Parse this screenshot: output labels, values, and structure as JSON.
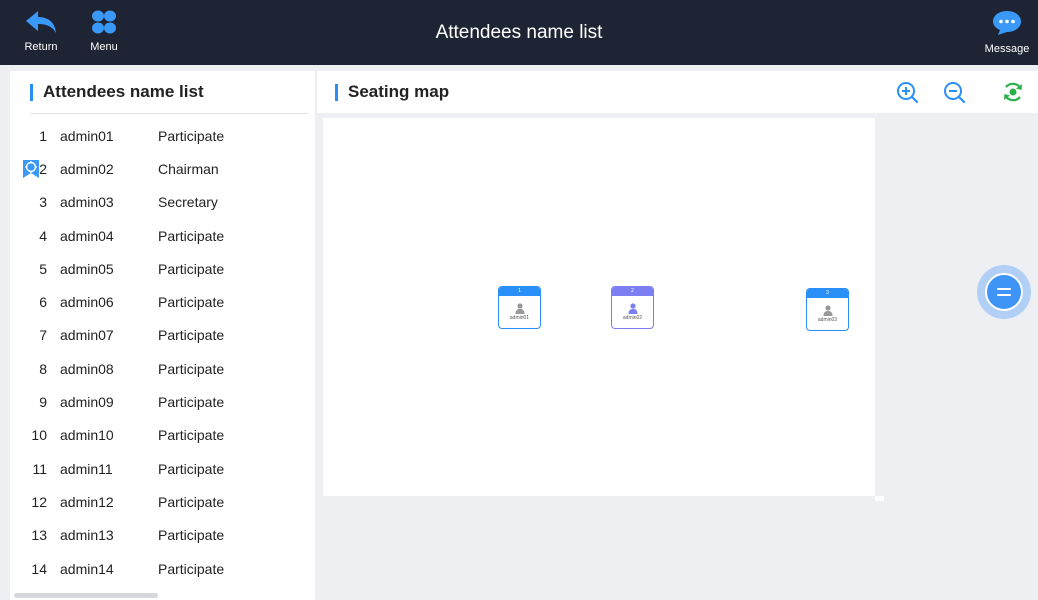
{
  "header": {
    "title": "Attendees name list",
    "return_label": "Return",
    "menu_label": "Menu",
    "message_label": "Message"
  },
  "left_panel": {
    "title": "Attendees name list",
    "attendees": [
      {
        "num": "1",
        "name": "admin01",
        "role": "Participate"
      },
      {
        "num": "2",
        "name": "admin02",
        "role": "Chairman"
      },
      {
        "num": "3",
        "name": "admin03",
        "role": "Secretary"
      },
      {
        "num": "4",
        "name": "admin04",
        "role": "Participate"
      },
      {
        "num": "5",
        "name": "admin05",
        "role": "Participate"
      },
      {
        "num": "6",
        "name": "admin06",
        "role": "Participate"
      },
      {
        "num": "7",
        "name": "admin07",
        "role": "Participate"
      },
      {
        "num": "8",
        "name": "admin08",
        "role": "Participate"
      },
      {
        "num": "9",
        "name": "admin09",
        "role": "Participate"
      },
      {
        "num": "10",
        "name": "admin10",
        "role": "Participate"
      },
      {
        "num": "11",
        "name": "admin11",
        "role": "Participate"
      },
      {
        "num": "12",
        "name": "admin12",
        "role": "Participate"
      },
      {
        "num": "13",
        "name": "admin13",
        "role": "Participate"
      },
      {
        "num": "14",
        "name": "admin14",
        "role": "Participate"
      }
    ]
  },
  "right_panel": {
    "title": "Seating map",
    "tools": [
      "zoom-in-icon",
      "zoom-out-icon",
      "refresh-icon"
    ],
    "seats": [
      {
        "num": "1",
        "name": "admin01",
        "color": "#2a8ff7"
      },
      {
        "num": "2",
        "name": "admin02",
        "color": "#7b7ff2"
      },
      {
        "num": "3",
        "name": "admin03",
        "color": "#2a8ff7"
      }
    ]
  },
  "colors": {
    "topbar": "#1e2434",
    "accent": "#2a8ff7",
    "chairman_seat": "#7b7ff2",
    "refresh": "#2bb14a"
  }
}
